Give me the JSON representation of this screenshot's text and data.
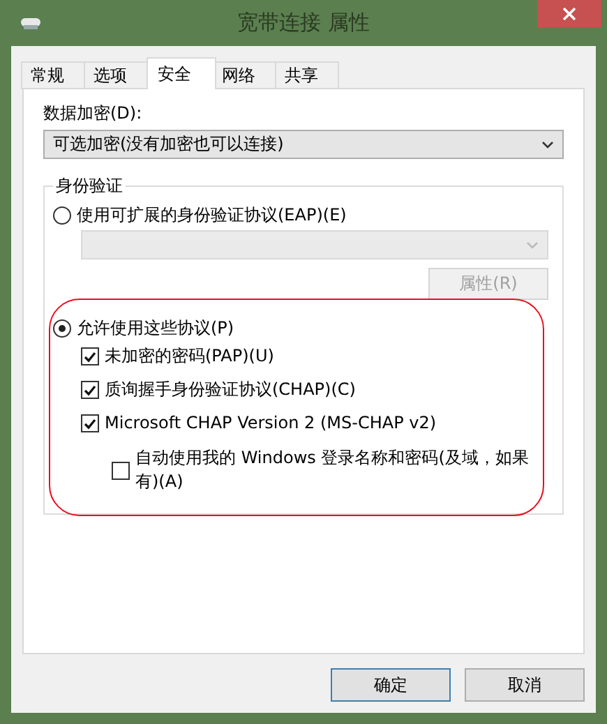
{
  "window": {
    "title": "宽带连接 属性"
  },
  "tabs": [
    {
      "label": "常规",
      "selected": false
    },
    {
      "label": "选项",
      "selected": false
    },
    {
      "label": "安全",
      "selected": true
    },
    {
      "label": "网络",
      "selected": false
    },
    {
      "label": "共享",
      "selected": false
    }
  ],
  "encryption": {
    "label": "数据加密(D):",
    "value": "可选加密(没有加密也可以连接)"
  },
  "authentication": {
    "title": "身份验证",
    "eap": {
      "label": "使用可扩展的身份验证协议(EAP)(E)",
      "selected": false,
      "select_disabled": true,
      "properties_button": {
        "label": "属性(R)",
        "disabled": true
      }
    },
    "allow": {
      "label": "允许使用这些协议(P)",
      "selected": true,
      "protocols": [
        {
          "label": "未加密的密码(PAP)(U)",
          "checked": true
        },
        {
          "label": "质询握手身份验证协议(CHAP)(C)",
          "checked": true
        },
        {
          "label": "Microsoft CHAP Version 2 (MS-CHAP v2)",
          "checked": true,
          "children": [
            {
              "label": "自动使用我的 Windows 登录名称和密码(及域，如果有)(A)",
              "checked": false
            }
          ]
        }
      ]
    }
  },
  "buttons": [
    {
      "label": "确定",
      "kind": "default"
    },
    {
      "label": "取消",
      "kind": "normal"
    }
  ]
}
